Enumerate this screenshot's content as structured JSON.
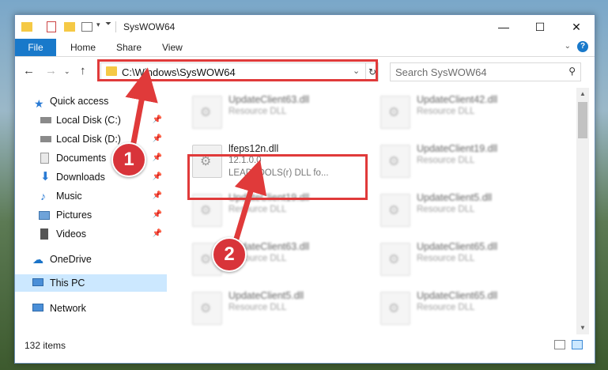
{
  "window": {
    "title": "SysWOW64",
    "minimize": "—",
    "maximize": "☐",
    "close": "✕"
  },
  "ribbon": {
    "file": "File",
    "home": "Home",
    "share": "Share",
    "view": "View",
    "help": "?"
  },
  "nav": {
    "address": "C:\\Windows\\SysWOW64",
    "search_placeholder": "Search SysWOW64"
  },
  "sidebar": {
    "items": [
      {
        "label": "Quick access"
      },
      {
        "label": "Local Disk (C:)"
      },
      {
        "label": "Local Disk (D:)"
      },
      {
        "label": "Documents"
      },
      {
        "label": "Downloads"
      },
      {
        "label": "Music"
      },
      {
        "label": "Pictures"
      },
      {
        "label": "Videos"
      },
      {
        "label": "OneDrive"
      },
      {
        "label": "This PC"
      },
      {
        "label": "Network"
      }
    ]
  },
  "files": {
    "highlighted": {
      "name": "lfeps12n.dll",
      "version": "12.1.0.0",
      "description": "LEADTOOLS(r) DLL fo..."
    },
    "items": [
      {
        "name": "UpdateClient63.dll",
        "desc": "Resource DLL"
      },
      {
        "name": "UpdateClient42.dll",
        "desc": "Resource DLL"
      },
      {
        "name": "UpdateClient19.dll",
        "desc": "Resource DLL"
      },
      {
        "name": "UpdateClient19.dll",
        "desc": "Resource DLL"
      },
      {
        "name": "UpdateClient5.dll",
        "desc": "Resource DLL"
      },
      {
        "name": "UpdateClient63.dll",
        "desc": "Resource DLL"
      },
      {
        "name": "UpdateClient65.dll",
        "desc": "Resource DLL"
      },
      {
        "name": "UpdateClient5.dll",
        "desc": "Resource DLL"
      },
      {
        "name": "UpdateClient65.dll",
        "desc": "Resource DLL"
      }
    ]
  },
  "status": {
    "count": "132 items"
  },
  "markers": {
    "one": "1",
    "two": "2"
  },
  "colors": {
    "accent": "#1979ca",
    "highlight": "#e03a3a",
    "selection": "#cce8ff"
  }
}
